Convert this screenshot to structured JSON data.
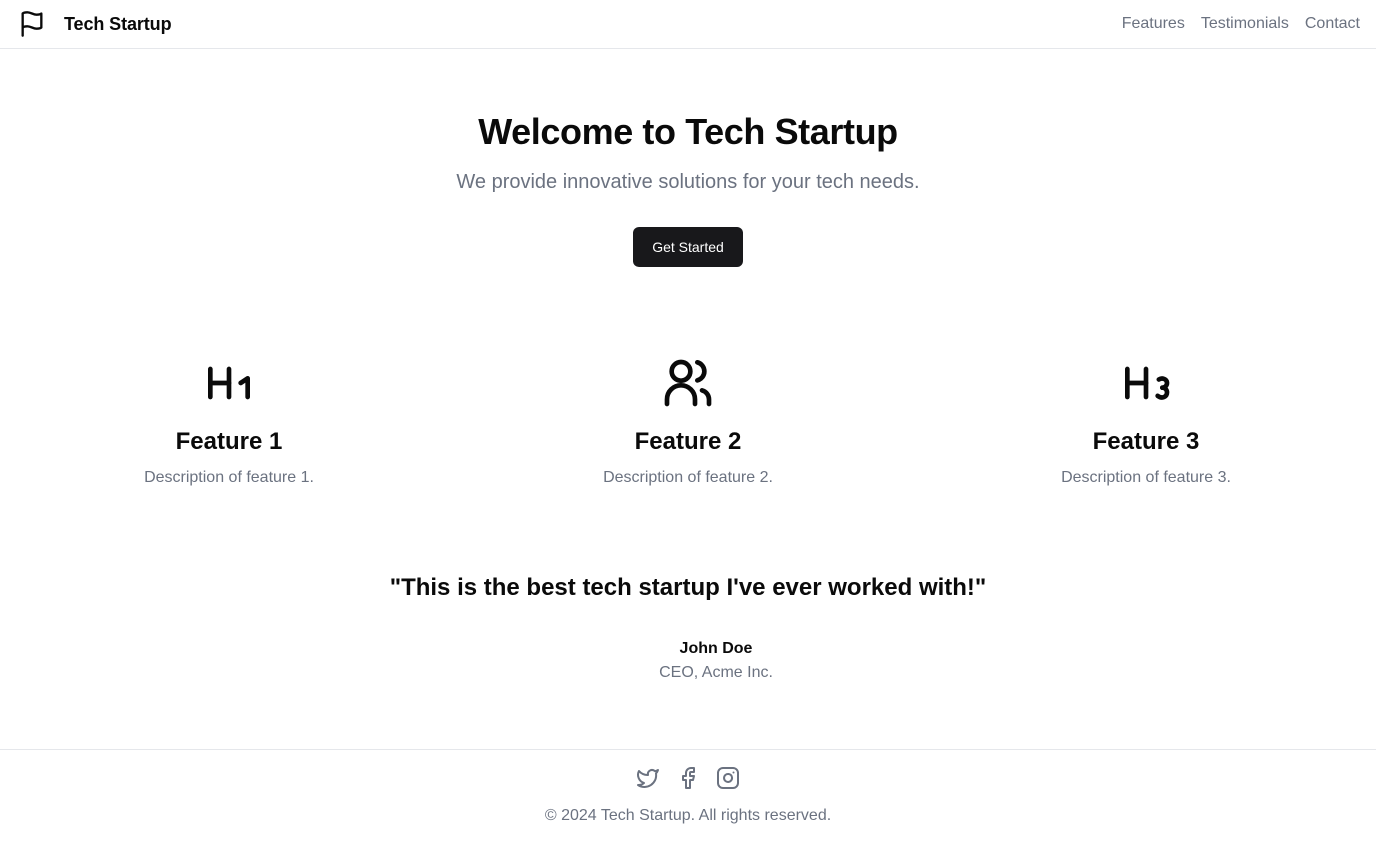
{
  "header": {
    "brand": "Tech Startup",
    "brand_icon": "flag-icon",
    "nav": [
      {
        "label": "Features"
      },
      {
        "label": "Testimonials"
      },
      {
        "label": "Contact"
      }
    ]
  },
  "hero": {
    "title": "Welcome to Tech Startup",
    "subtitle": "We provide innovative solutions for your tech needs.",
    "cta_label": "Get Started"
  },
  "features": [
    {
      "icon": "heading-1-icon",
      "title": "Feature 1",
      "description": "Description of feature 1."
    },
    {
      "icon": "users-icon",
      "title": "Feature 2",
      "description": "Description of feature 2."
    },
    {
      "icon": "heading-3-icon",
      "title": "Feature 3",
      "description": "Description of feature 3."
    }
  ],
  "testimonial": {
    "quote": "\"This is the best tech startup I've ever worked with!\"",
    "author": "John Doe",
    "role": "CEO, Acme Inc."
  },
  "footer": {
    "socials": [
      {
        "icon": "twitter-icon"
      },
      {
        "icon": "facebook-icon"
      },
      {
        "icon": "instagram-icon"
      }
    ],
    "copyright": "© 2024 Tech Startup. All rights reserved."
  },
  "colors": {
    "text": "#0a0a0a",
    "muted": "#6b7280",
    "button": "#18181b",
    "border": "#e5e7eb"
  }
}
